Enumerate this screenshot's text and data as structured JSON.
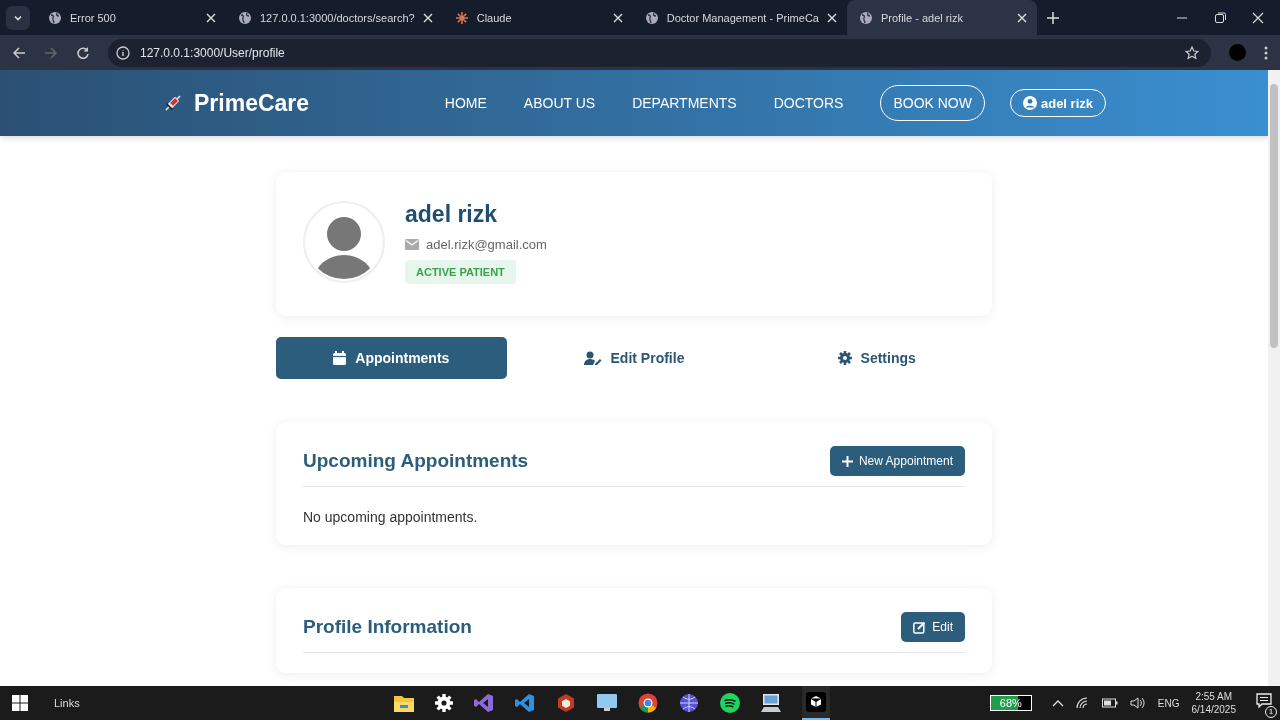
{
  "browser": {
    "tabs": [
      {
        "title": "Error 500",
        "kind": "globe",
        "selected": false
      },
      {
        "title": "127.0.0.1:3000/doctors/search?",
        "kind": "globe",
        "selected": false
      },
      {
        "title": "Claude",
        "kind": "claude",
        "selected": false
      },
      {
        "title": "Doctor Management - PrimeCa",
        "kind": "globe",
        "selected": false
      },
      {
        "title": "Profile - adel rizk",
        "kind": "globe",
        "selected": true
      }
    ],
    "address": "127.0.0.1:3000/User/profile"
  },
  "site": {
    "brand": "PrimeCare",
    "nav": [
      {
        "label": "HOME",
        "kind": "link"
      },
      {
        "label": "ABOUT US",
        "kind": "link"
      },
      {
        "label": "DEPARTMENTS",
        "kind": "link"
      },
      {
        "label": "DOCTORS",
        "kind": "link"
      },
      {
        "label": "BOOK NOW",
        "kind": "outline"
      },
      {
        "label": "adel rizk",
        "kind": "user"
      }
    ]
  },
  "profile": {
    "name": "adel rizk",
    "email": "adel.rizk@gmail.com",
    "badge": "ACTIVE PATIENT"
  },
  "profile_tabs": [
    {
      "label": "Appointments",
      "kind": "calendar",
      "selected": true
    },
    {
      "label": "Edit Profile",
      "kind": "user-edit",
      "selected": false
    },
    {
      "label": "Settings",
      "kind": "gear",
      "selected": false
    }
  ],
  "appointments": {
    "title": "Upcoming Appointments",
    "button": "New Appointment",
    "empty": "No upcoming appointments."
  },
  "profile_info": {
    "title": "Profile Information",
    "button": "Edit"
  },
  "taskbar": {
    "links": "Links",
    "battery": {
      "level": 0.68,
      "reading": "68%"
    },
    "language": "ENG",
    "time": "2:55 AM",
    "date": "6/14/2025",
    "notifications": "1"
  }
}
